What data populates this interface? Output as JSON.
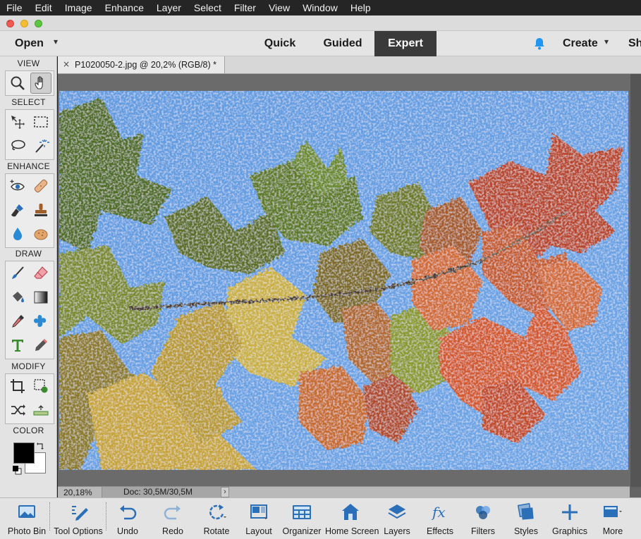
{
  "menubar": {
    "items": [
      "File",
      "Edit",
      "Image",
      "Enhance",
      "Layer",
      "Select",
      "Filter",
      "View",
      "Window",
      "Help"
    ]
  },
  "modebar": {
    "open_label": "Open",
    "tabs": [
      "Quick",
      "Guided",
      "Expert"
    ],
    "active_tab": "Expert",
    "create_label": "Create",
    "share_label": "Sh",
    "accent": "#2196f3"
  },
  "toolbox": {
    "sections": [
      "VIEW",
      "SELECT",
      "ENHANCE",
      "DRAW",
      "MODIFY",
      "COLOR"
    ],
    "view_tools": [
      "zoom-icon",
      "hand-icon"
    ],
    "select_tools": [
      "move-icon",
      "marquee-icon",
      "lasso-icon",
      "magic-wand-icon"
    ],
    "enhance_tools": [
      "red-eye-icon",
      "spot-healing-icon",
      "smart-brush-icon",
      "clone-stamp-icon",
      "blur-icon",
      "sponge-icon"
    ],
    "draw_tools": [
      "brush-icon",
      "eraser-icon",
      "paint-bucket-icon",
      "gradient-icon",
      "eyedropper-icon",
      "custom-shape-icon",
      "type-icon",
      "pencil-icon"
    ],
    "modify_tools": [
      "crop-icon",
      "recompose-icon",
      "content-aware-move-icon",
      "straighten-icon"
    ],
    "foreground_color": "#000000",
    "background_color": "#ffffff"
  },
  "document": {
    "tab_title": "P1020050-2.jpg @ 20,2% (RGB/8) *",
    "close_glyph": "×"
  },
  "statusbar": {
    "zoom": "20,18%",
    "doc_size": "Doc: 30,5M/30,5M",
    "arrow": "›"
  },
  "bottombar": {
    "items": [
      "Photo Bin",
      "Tool Options",
      "Undo",
      "Redo",
      "Rotate",
      "Layout",
      "Organizer",
      "Home Screen",
      "Layers",
      "Effects",
      "Filters",
      "Styles",
      "Graphics",
      "More"
    ],
    "icon_color": "#2a6fb8"
  }
}
